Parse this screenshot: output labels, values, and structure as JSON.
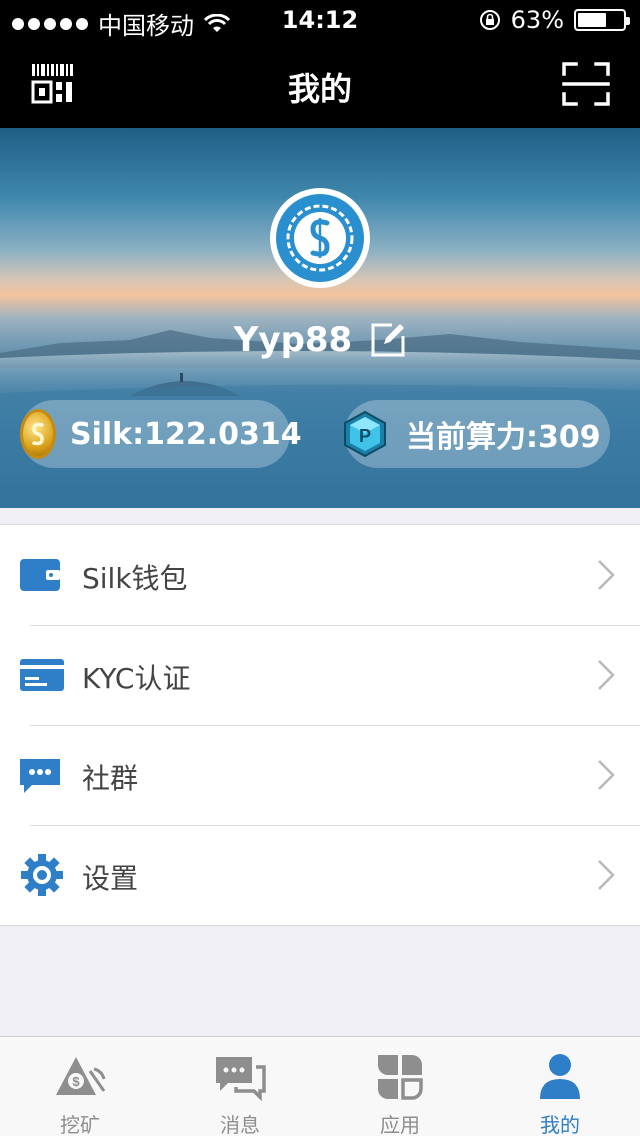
{
  "status_bar": {
    "carrier": "中国移动",
    "time": "14:12",
    "battery_text": "63%",
    "battery_level": 0.63,
    "icons": [
      "signal-dots-icon",
      "wifi-icon",
      "rotation-lock-icon",
      "battery-icon"
    ]
  },
  "nav": {
    "title": "我的",
    "left_icon": "qr-code-icon",
    "right_icon": "scan-icon"
  },
  "profile": {
    "username": "Yyp88",
    "edit_icon": "edit-icon",
    "silk_balance": "Silk:122.0314",
    "hash_power": "当前算力:309"
  },
  "menu": [
    {
      "label": "Silk钱包",
      "icon": "wallet-icon"
    },
    {
      "label": "KYC认证",
      "icon": "id-card-icon"
    },
    {
      "label": "社群",
      "icon": "chat-bubble-icon"
    },
    {
      "label": "设置",
      "icon": "gear-icon"
    }
  ],
  "tabs": [
    {
      "label": "挖矿",
      "icon": "mining-icon",
      "active": false
    },
    {
      "label": "消息",
      "icon": "messages-icon",
      "active": false
    },
    {
      "label": "应用",
      "icon": "apps-icon",
      "active": false
    },
    {
      "label": "我的",
      "icon": "profile-icon",
      "active": true
    }
  ],
  "colors": {
    "accent": "#2f7fc8",
    "nav_bg": "#000000",
    "page_bg": "#efeff4",
    "tab_inactive": "#8e8e8e"
  }
}
